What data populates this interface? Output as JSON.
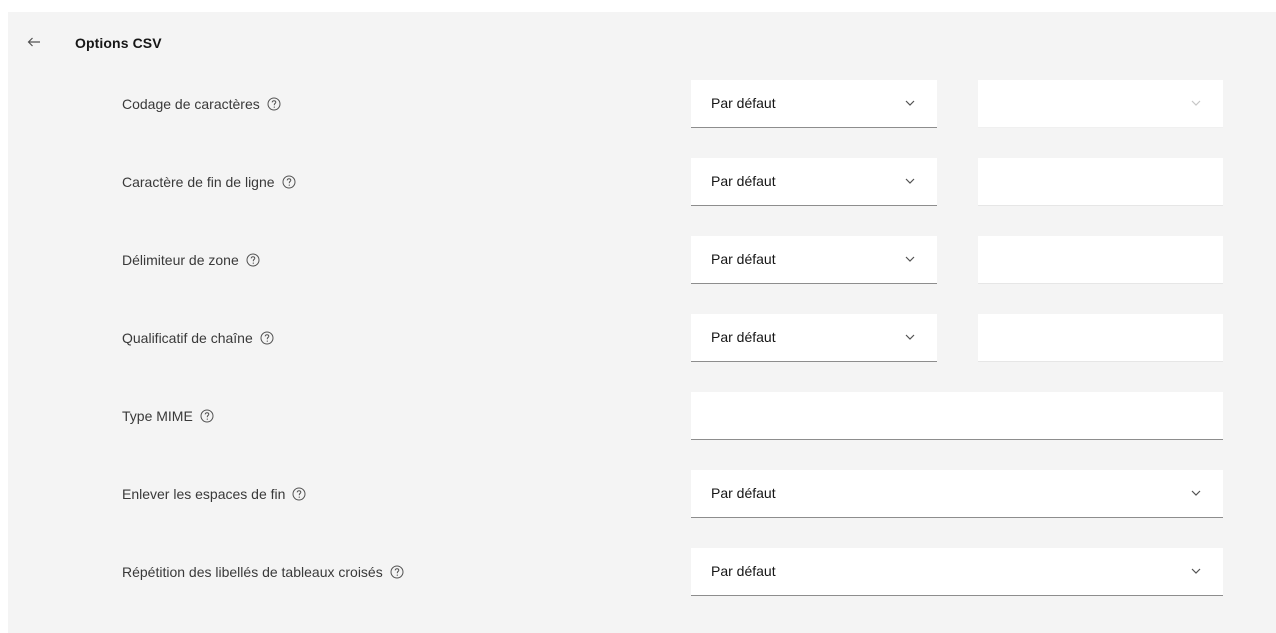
{
  "header": {
    "title": "Options CSV",
    "back_icon": "arrow-left-icon"
  },
  "rows": [
    {
      "label": "Codage de caractères",
      "select_value": "Par défaut",
      "side": "disabled-select",
      "side_value": ""
    },
    {
      "label": "Caractère de fin de ligne",
      "select_value": "Par défaut",
      "side": "text-input",
      "side_value": ""
    },
    {
      "label": "Délimiteur de zone",
      "select_value": "Par défaut",
      "side": "text-input",
      "side_value": ""
    },
    {
      "label": "Qualificatif de chaîne",
      "select_value": "Par défaut",
      "side": "text-input",
      "side_value": ""
    },
    {
      "label": "Type MIME",
      "input_value": ""
    },
    {
      "label": "Enlever les espaces de fin",
      "select_value": "Par défaut"
    },
    {
      "label": "Répétition des libellés de tableaux croisés",
      "select_value": "Par défaut"
    }
  ],
  "icons": {
    "help": "help-circle-icon",
    "chevron": "chevron-down-icon"
  },
  "colors": {
    "panel_bg": "#f4f4f4",
    "field_bg": "#ffffff",
    "text_primary": "#161616",
    "text_label": "#393939"
  }
}
